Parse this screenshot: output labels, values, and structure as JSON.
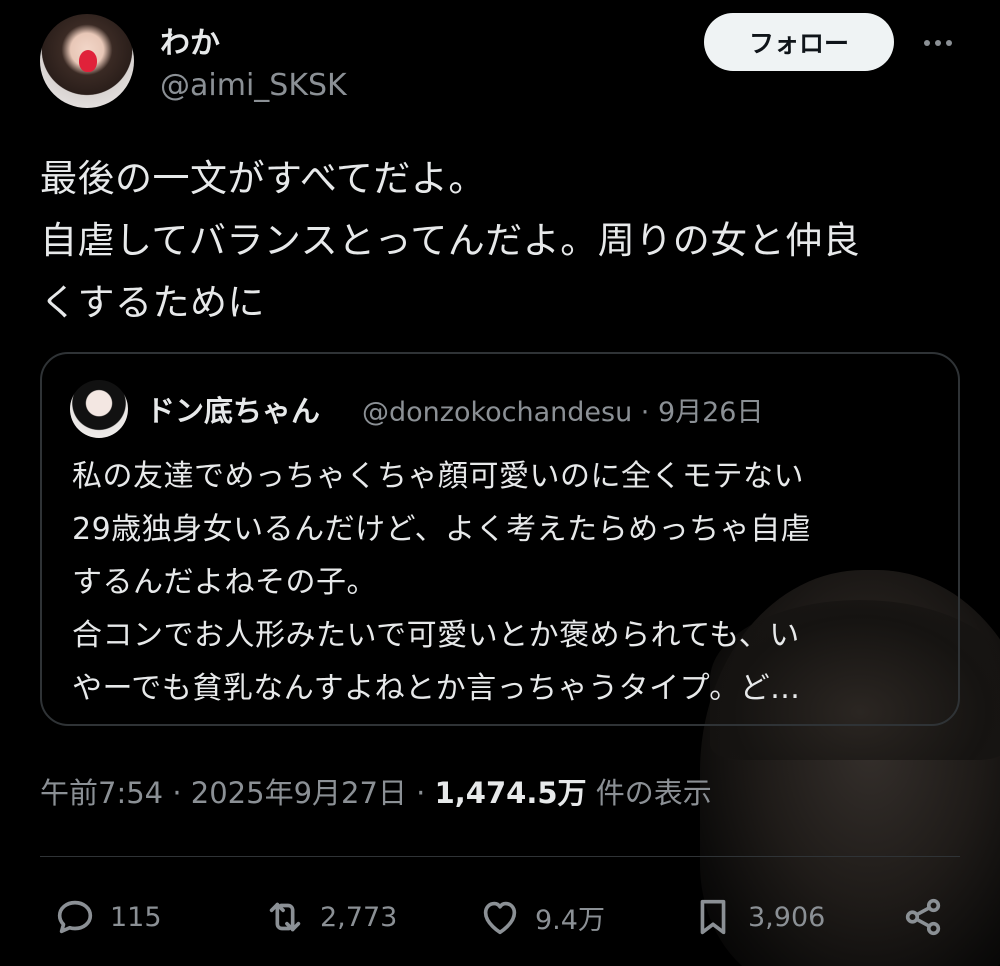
{
  "author": {
    "display_name": "わか",
    "handle": "@aimi_SKSK"
  },
  "follow_button_label": "フォロー",
  "tweet_lines": [
    "最後の一文がすべてだよ。",
    "自虐してバランスとってんだよ。周りの女と仲良",
    "くするために"
  ],
  "quote": {
    "display_name": "ドン底ちゃん",
    "handle_date": "@donzokochandesu · 9月26日",
    "lines": [
      "私の友達でめっちゃくちゃ顔可愛いのに全くモテない",
      "29歳独身女いるんだけど、よく考えたらめっちゃ自虐",
      "するんだよねその子。",
      "合コンでお人形みたいで可愛いとか褒められても、い",
      "やーでも貧乳なんすよねとか言っちゃうタイプ。ど..."
    ]
  },
  "meta": {
    "time_date": "午前7:54 · 2025年9月27日 · ",
    "views": "1,474.5万",
    "views_suffix": " 件の表示"
  },
  "actions": {
    "replies": "115",
    "reposts": "2,773",
    "likes": "9.4万",
    "bookmarks": "3,906"
  },
  "icons": [
    "more-icon",
    "reply-icon",
    "repost-icon",
    "like-icon",
    "bookmark-icon",
    "share-icon"
  ],
  "colors": {
    "background": "#000000",
    "text_primary": "#e7e9ea",
    "text_secondary": "#8b9095",
    "border": "#2f3336",
    "follow_button_bg": "#eff3f4"
  }
}
